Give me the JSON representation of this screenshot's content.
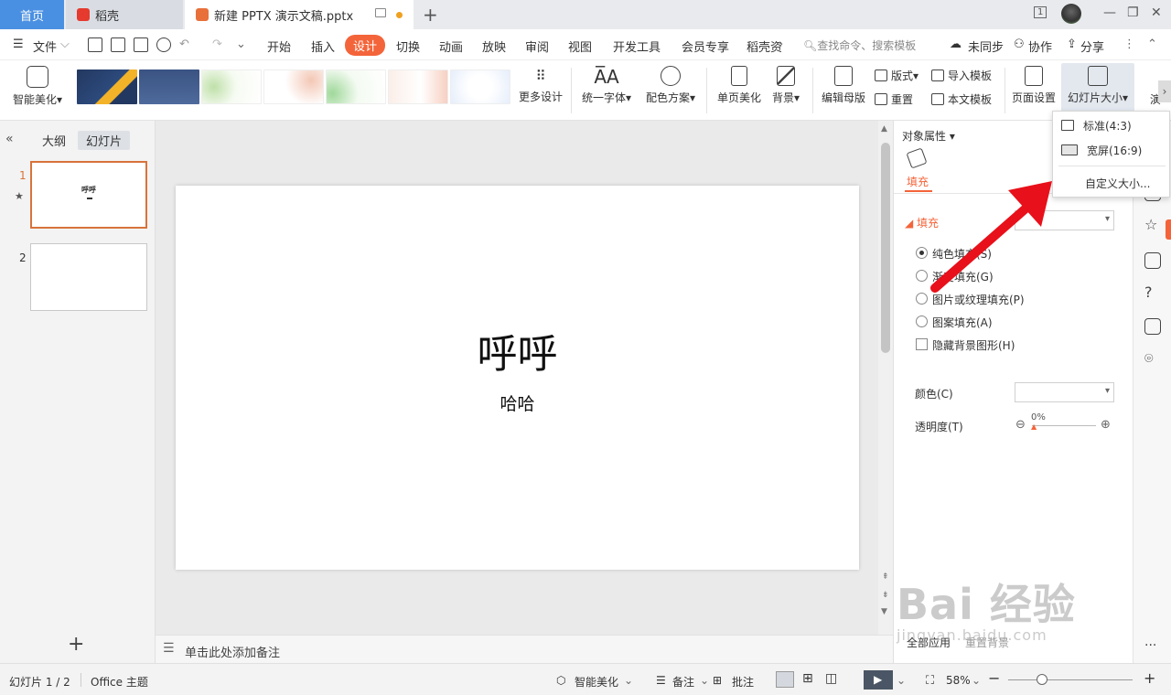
{
  "tabs": {
    "home": "首页",
    "daoke": "稻壳",
    "doc": "新建 PPTX 演示文稿.pptx",
    "badge": "1"
  },
  "menu": {
    "file": "文件",
    "items": [
      "开始",
      "插入",
      "设计",
      "切换",
      "动画",
      "放映",
      "审阅",
      "视图",
      "开发工具",
      "会员专享",
      "稻壳资"
    ],
    "active": "设计",
    "search": "查找命令、搜索模板",
    "unsync": "未同步",
    "collab": "协作",
    "share": "分享"
  },
  "ribbon": {
    "smart_beautify": "智能美化",
    "more_design": "更多设计",
    "unify_font": "统一字体",
    "color_scheme": "配色方案",
    "page_beautify": "单页美化",
    "background": "背景",
    "edit_master": "编辑母版",
    "layout": "版式",
    "reset": "重置",
    "import_template": "导入模板",
    "this_template": "本文模板",
    "page_setup": "页面设置",
    "slide_size": "幻灯片大小",
    "more": "演"
  },
  "left_panel": {
    "outline": "大纲",
    "slides": "幻灯片",
    "slide1_num": "1",
    "slide2_num": "2",
    "slide1_title": "呼呼",
    "star": "★"
  },
  "slide": {
    "title": "呼呼",
    "subtitle": "哈哈"
  },
  "notes_placeholder": "单击此处添加备注",
  "properties": {
    "header": "对象属性",
    "tab_fill": "填充",
    "section_fill": "填充",
    "opt_solid": "纯色填充(S)",
    "opt_gradient": "渐变填充(G)",
    "opt_picture": "图片或纹理填充(P)",
    "opt_pattern": "图案填充(A)",
    "hide_bg": "隐藏背景图形(H)",
    "color": "颜色(C)",
    "transparency": "透明度(T)",
    "transparency_value": "0%",
    "apply_all": "全部应用",
    "reset_bg": "重置背景"
  },
  "slide_size_menu": {
    "standard": "标准(4:3)",
    "widescreen": "宽屏(16:9)",
    "custom": "自定义大小..."
  },
  "status": {
    "slide_count": "幻灯片 1 / 2",
    "theme": "Office 主题",
    "smart_beautify": "智能美化",
    "notes": "备注",
    "comments": "批注",
    "zoom": "58%"
  },
  "watermark": {
    "brand": "Bai 经验",
    "url": "jingyan.baidu.com"
  },
  "colors": {
    "accent": "#f4643a",
    "home_tab": "#4a90e2",
    "arrow": "#e8101a"
  }
}
